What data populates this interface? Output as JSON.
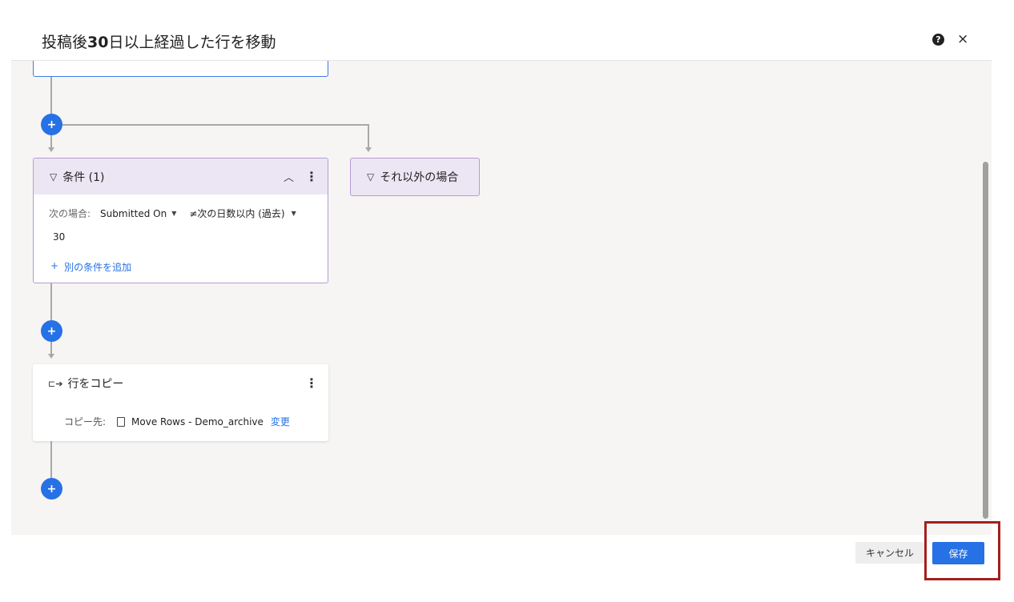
{
  "dialog": {
    "title_prefix": "投稿後",
    "title_bold": "30",
    "title_suffix": "日以上経過した行を移動",
    "help_icon": "?",
    "close_icon": "×"
  },
  "workflow": {
    "add_icon": "+",
    "condition": {
      "title": "条件 (1)",
      "when_label": "次の場合:",
      "field": "Submitted On",
      "operator": "≠次の日数以内 (過去)",
      "value": "30",
      "add_condition": "別の条件を追加"
    },
    "else_branch": {
      "title": "それ以外の場合"
    },
    "copy_action": {
      "title": "行をコピー",
      "dest_label": "コピー先:",
      "dest_sheet": "Move Rows - Demo_archive",
      "change_link": "変更"
    }
  },
  "footer": {
    "cancel_label": "キャンセル",
    "save_label": "保存"
  }
}
